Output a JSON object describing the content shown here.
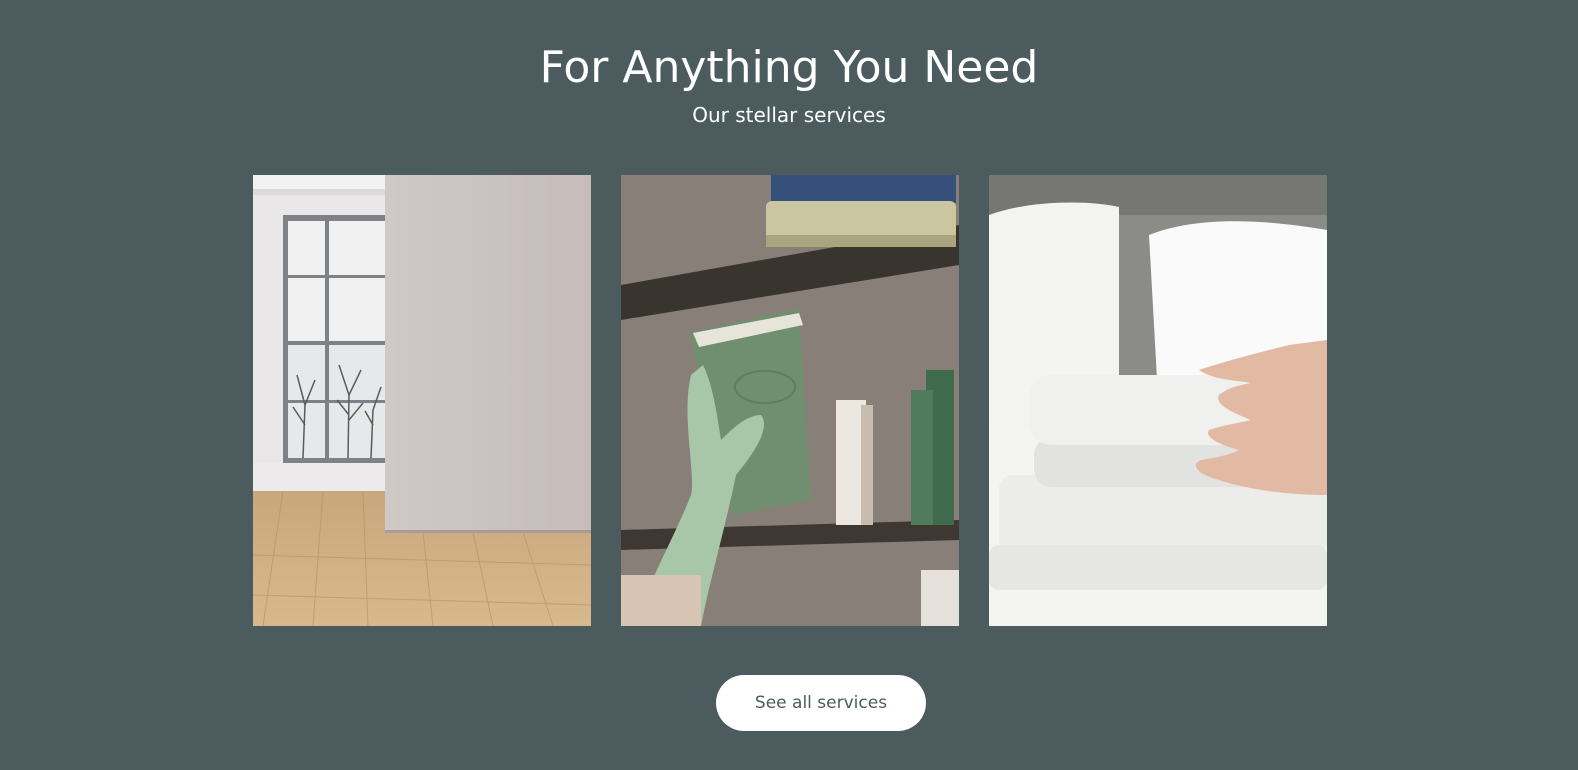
{
  "section": {
    "title": "For Anything You Need",
    "subtitle": "Our stellar services"
  },
  "cards": [
    {
      "image": "empty-room-with-window-and-wood-floor"
    },
    {
      "image": "gloved-hand-placing-green-book-on-shelf"
    },
    {
      "image": "hand-folding-white-towels-on-bed"
    }
  ],
  "cta": {
    "label": "See all services"
  },
  "colors": {
    "background": "#4b5b5e",
    "text": "#ffffff",
    "button_bg": "#ffffff",
    "button_text": "#4b5b5e"
  }
}
